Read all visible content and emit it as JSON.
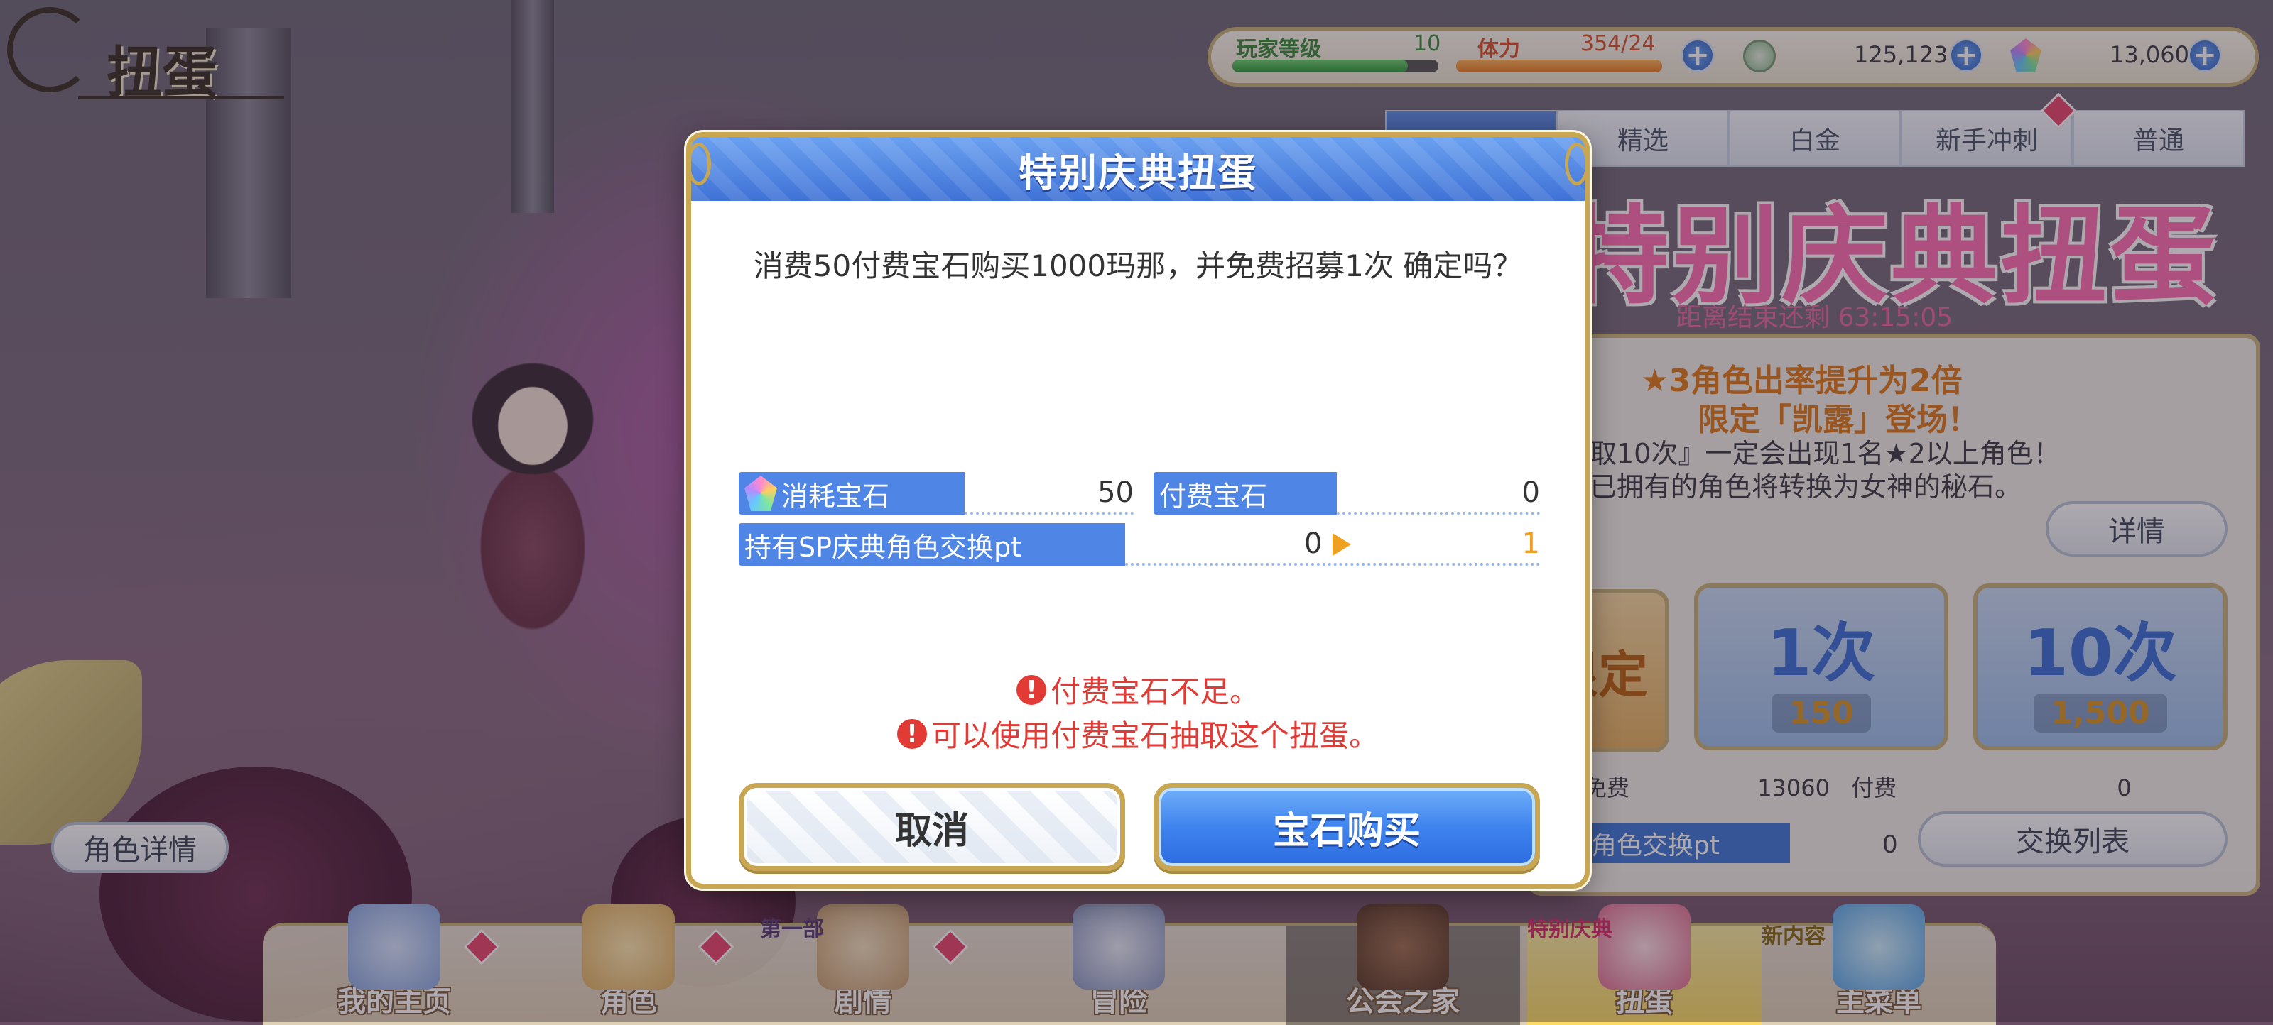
{
  "screen_title": "扭蛋",
  "status_bar": {
    "player_level_label": "玩家等级",
    "player_level_value": "10",
    "player_level_progress": 0.85,
    "stamina_label": "体力",
    "stamina_value": "354/24",
    "stamina_progress": 1.0,
    "mana_value": "125,123",
    "gems_value": "13,060"
  },
  "tabs": [
    {
      "label": "",
      "active": true
    },
    {
      "label": "精选",
      "active": false
    },
    {
      "label": "白金",
      "active": false
    },
    {
      "label": "新手冲刺",
      "active": false
    },
    {
      "label": "普通",
      "active": false
    }
  ],
  "banner": {
    "title": "特别庆典扭蛋",
    "countdown": "距离结束还剩 63:15:05",
    "promo_line1": "★3角色出率提升为2倍",
    "promo_line2": "限定「凯露」登场！",
    "promo_line3": "抽取10次』一定会出现1名★2以上角色！",
    "promo_line4": "涂已拥有的角色将转换为女神的秘石。",
    "details_button": "详情",
    "limited_label": "限定",
    "single_pull": {
      "label": "1次",
      "cost": "150"
    },
    "ten_pull": {
      "label": "10次",
      "cost": "1,500"
    },
    "free_gems_label": "免费",
    "free_gems_value": "13060",
    "paid_gems_label": "付费",
    "paid_gems_value": "0",
    "exchange_pt_label": "角色交换pt",
    "exchange_pt_value": "0",
    "exchange_list_button": "交换列表"
  },
  "character_detail_button": "角色详情",
  "bottom_nav": [
    {
      "label": "我的主页"
    },
    {
      "label": "角色"
    },
    {
      "label": "剧情",
      "tag": "第一部"
    },
    {
      "label": "冒险"
    },
    {
      "label": "公会之家"
    },
    {
      "label": "扭蛋",
      "tag": "特别庆典"
    },
    {
      "label": "主菜单",
      "tag": "新内容"
    }
  ],
  "dialog": {
    "title": "特别庆典扭蛋",
    "message": "消费50付费宝石购买1000玛那，并免费招募1次 确定吗？",
    "consume_gems_label": "消耗宝石",
    "consume_gems_value": "50",
    "paid_gems_label": "付费宝石",
    "paid_gems_value": "0",
    "sp_pt_label": "持有SP庆典角色交换pt",
    "sp_pt_current": "0",
    "sp_pt_after": "1",
    "warning1": "付费宝石不足。",
    "warning2": "可以使用付费宝石抽取这个扭蛋。",
    "cancel_button": "取消",
    "buy_button": "宝石购买"
  },
  "colors": {
    "dialog_header": "#3f72d6",
    "warning_text": "#e23a34",
    "pt_after": "#f0a020",
    "frame_gold": "#c9a752"
  }
}
